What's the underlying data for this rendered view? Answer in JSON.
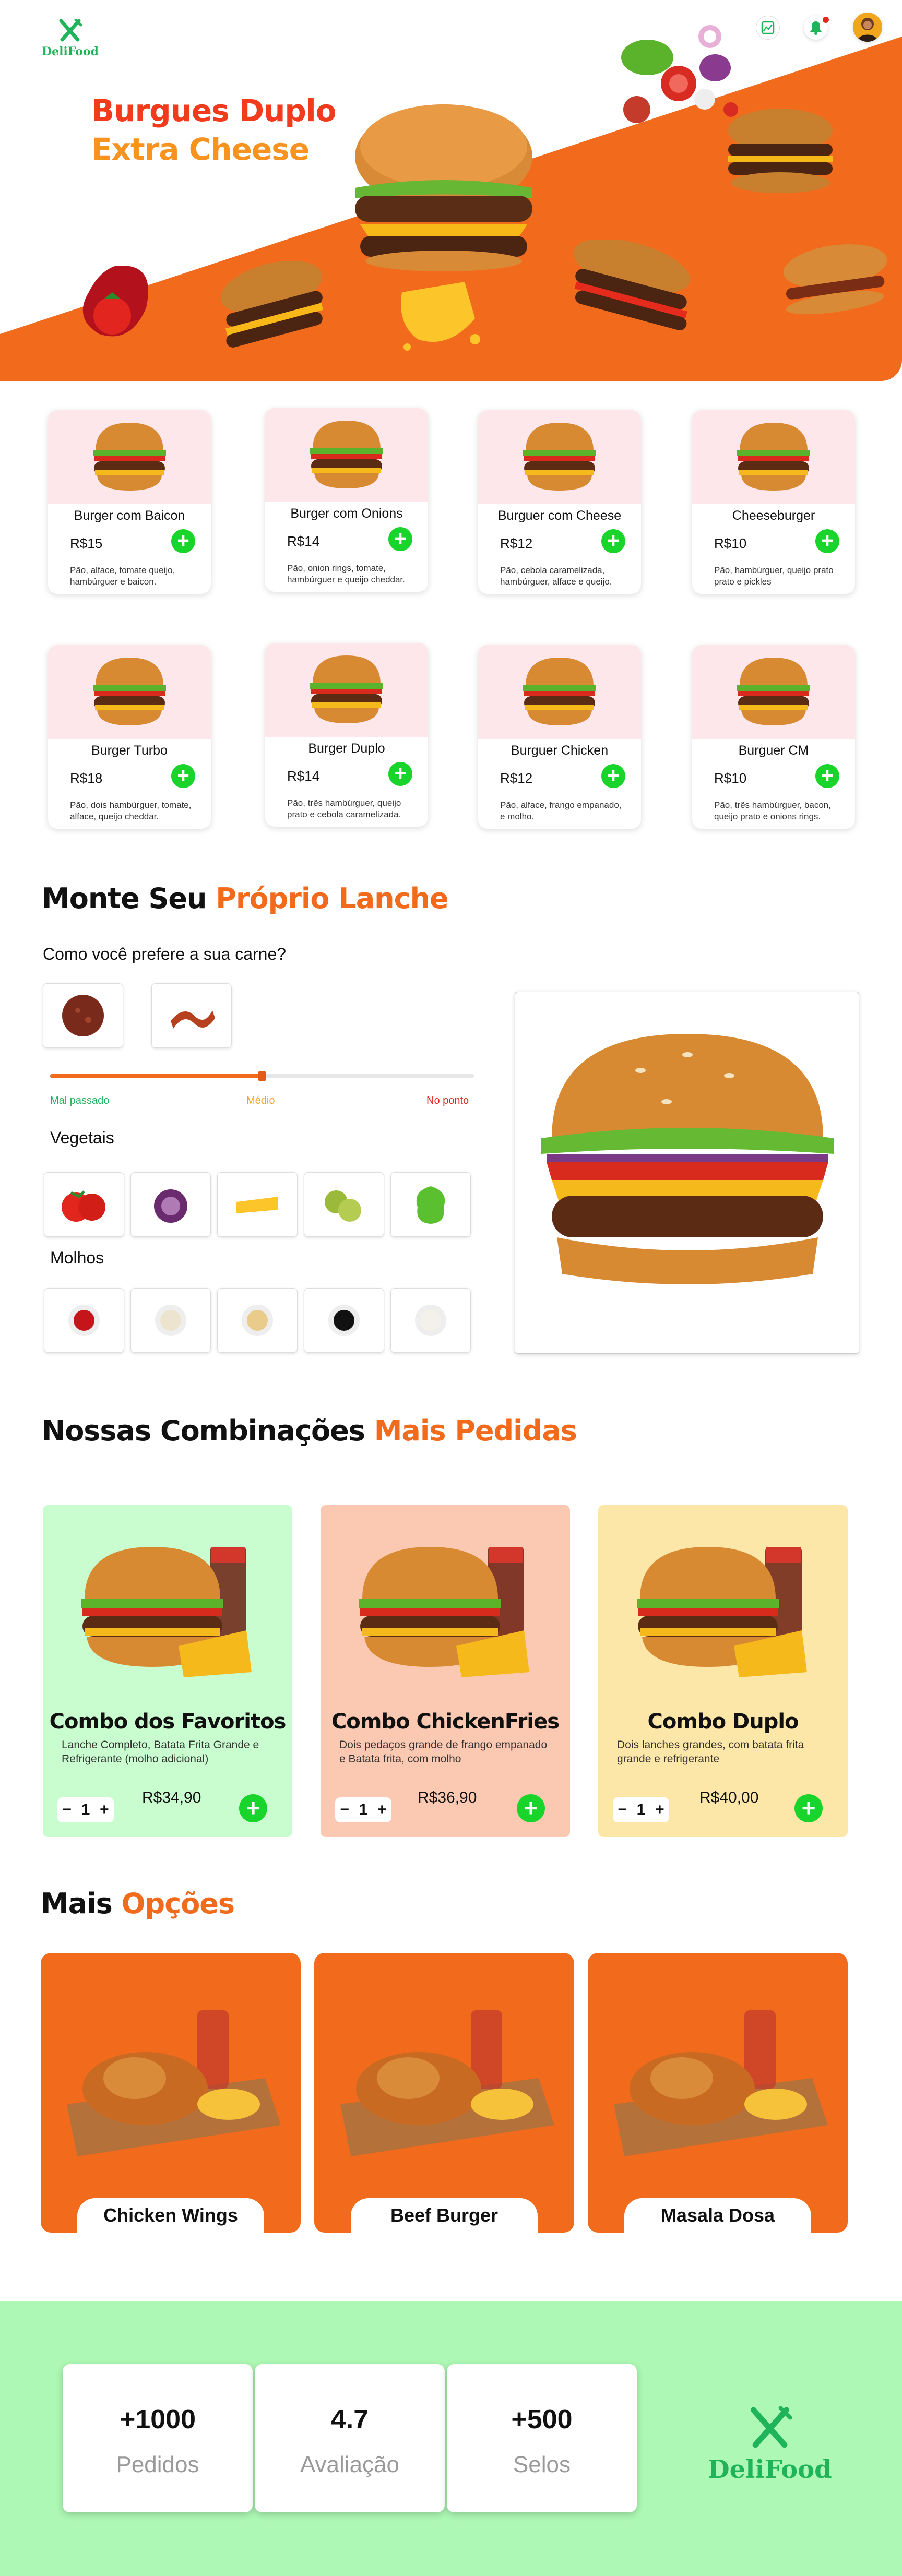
{
  "brand": {
    "name": "DeliFood"
  },
  "hero": {
    "title_line1": "Burgues Duplo",
    "title_line2": "Extra Cheese"
  },
  "colors": {
    "accent_orange": "#f26a1c",
    "brand_green": "#1fb35a",
    "add_green": "#19d42a",
    "footer_green": "#adf8b4"
  },
  "topbar": {
    "icons": [
      "chart-icon",
      "bell-icon",
      "user-avatar"
    ]
  },
  "products": [
    {
      "name": "Burger com Baicon",
      "price": "R$15",
      "desc": "Pão, alface, tomate queijo, hambúrguer e baicon."
    },
    {
      "name": "Burger com Onions",
      "price": "R$14",
      "desc": "Pão, onion rings, tomate, hambúrguer e queijo cheddar."
    },
    {
      "name": "Burguer com Cheese",
      "price": "R$12",
      "desc": "Pão, cebola caramelizada, hambúrguer, alface e queijo."
    },
    {
      "name": "Cheeseburger",
      "price": "R$10",
      "desc": "Pão, hambúrguer, queijo prato prato e pickles"
    },
    {
      "name": "Burger Turbo",
      "price": "R$18",
      "desc": "Pão, dois hambúrguer, tomate, alface, queijo cheddar."
    },
    {
      "name": "Burger Duplo",
      "price": "R$14",
      "desc": "Pão, três hambúrguer, queijo prato e cebola caramelizada."
    },
    {
      "name": "Burguer Chicken",
      "price": "R$12",
      "desc": "Pão, alface, frango empanado, e molho."
    },
    {
      "name": "Burguer CM",
      "price": "R$10",
      "desc": "Pão, três hambúrguer, bacon, queijo prato e onions rings."
    }
  ],
  "builder": {
    "title_black": "Monte Seu",
    "title_orange": "Próprio Lanche",
    "question": "Como você prefere a sua carne?",
    "doneness": {
      "rare": "Mal passado",
      "medium": "Médio",
      "well": "No ponto",
      "value": 0.5
    },
    "veg_label": "Vegetais",
    "sauce_label": "Molhos"
  },
  "combos_section": {
    "title_black": "Nossas Combinações",
    "title_orange": "Mais Pedidas"
  },
  "combos": [
    {
      "title": "Combo dos Favoritos",
      "desc": "Lanche Completo, Batata Frita Grande e Refrigerante (molho adicional)",
      "price": "R$34,90",
      "qty": "1",
      "color": "#c9fdd0"
    },
    {
      "title": "Combo ChickenFries",
      "desc": "Dois pedaços grande de frango empanado e Batata frita, com molho",
      "price": "R$36,90",
      "qty": "1",
      "color": "#fbc8b1"
    },
    {
      "title": "Combo Duplo",
      "desc": "Dois lanches grandes, com batata frita grande e refrigerante",
      "price": "R$40,00",
      "qty": "1",
      "color": "#fde7a8"
    }
  ],
  "more_section": {
    "title_black": "Mais",
    "title_orange": "Opções"
  },
  "more": [
    {
      "name": "Chicken Wings"
    },
    {
      "name": "Beef Burger"
    },
    {
      "name": "Masala Dosa"
    }
  ],
  "stats": [
    {
      "value": "+1000",
      "label": "Pedidos"
    },
    {
      "value": "4.7",
      "label": "Avaliação"
    },
    {
      "value": "+500",
      "label": "Selos"
    }
  ]
}
